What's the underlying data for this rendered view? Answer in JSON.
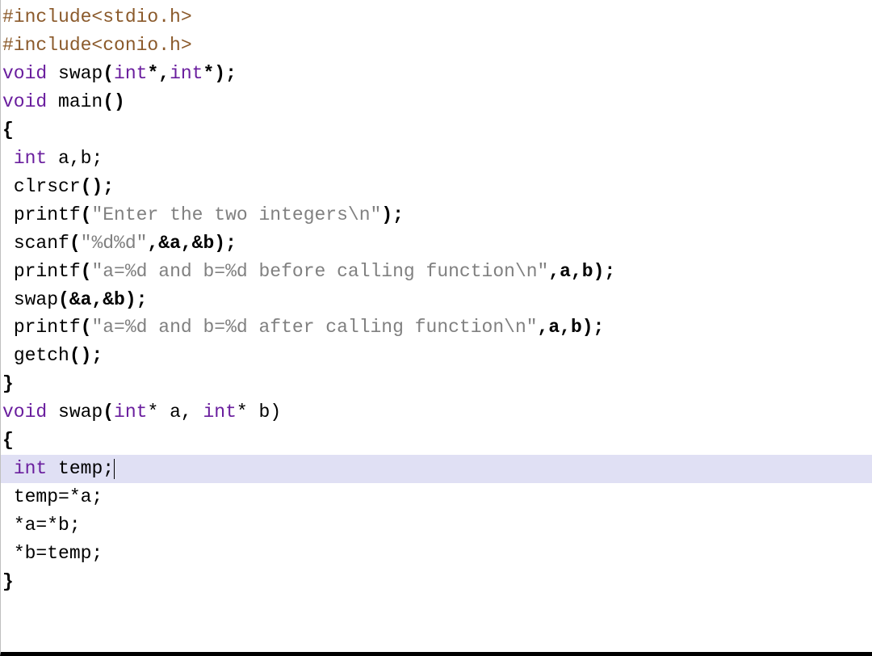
{
  "code": {
    "l01": {
      "pp": "#include<stdio.h>"
    },
    "l02": {
      "pp": "#include<conio.h>"
    },
    "l03": {
      "kw1": "void",
      "fn": " swap",
      "p1": "(",
      "typ1": "int",
      "p2": "*,",
      "typ2": "int",
      "p3": "*);"
    },
    "l04": {
      "kw1": "void",
      "fn": " main",
      "p1": "()"
    },
    "l05": {
      "brace": "{"
    },
    "l06": {
      "indent": " ",
      "kw": "int",
      "rest": " a,b;"
    },
    "l07": {
      "indent": " ",
      "fn": "clrscr",
      "p": "();"
    },
    "l08": {
      "indent": " ",
      "fn": "printf",
      "p1": "(",
      "str": "\"Enter the two integers\\n\"",
      "p2": ");"
    },
    "l09": {
      "indent": " ",
      "fn": "scanf",
      "p1": "(",
      "str": "\"%d%d\"",
      "p2": ",&a,&b);"
    },
    "l10": {
      "indent": " ",
      "fn": "printf",
      "p1": "(",
      "str": "\"a=%d and b=%d before calling function\\n\"",
      "p2": ",a,b);"
    },
    "l11": {
      "indent": " ",
      "fn": "swap",
      "p": "(&a,&b);"
    },
    "l12": {
      "indent": " ",
      "fn": "printf",
      "p1": "(",
      "str": "\"a=%d and b=%d after calling function\\n\"",
      "p2": ",a,b);"
    },
    "l13": {
      "indent": " ",
      "fn": "getch",
      "p": "();"
    },
    "l14": {
      "brace": "}"
    },
    "l15": {
      "kw1": "void",
      "fn": " swap",
      "p1": "(",
      "typ1": "int",
      "p2": "* a, ",
      "typ2": "int",
      "p3": "* b)"
    },
    "l16": {
      "brace": "{"
    },
    "l17": {
      "indent": " ",
      "kw": "int",
      "rest": " temp;"
    },
    "l18": {
      "indent": " ",
      "txt": "temp=*a;"
    },
    "l19": {
      "indent": " ",
      "txt": "*a=*b;"
    },
    "l20": {
      "indent": " ",
      "txt": "*b=temp;"
    },
    "l21": {
      "brace": "}"
    }
  }
}
